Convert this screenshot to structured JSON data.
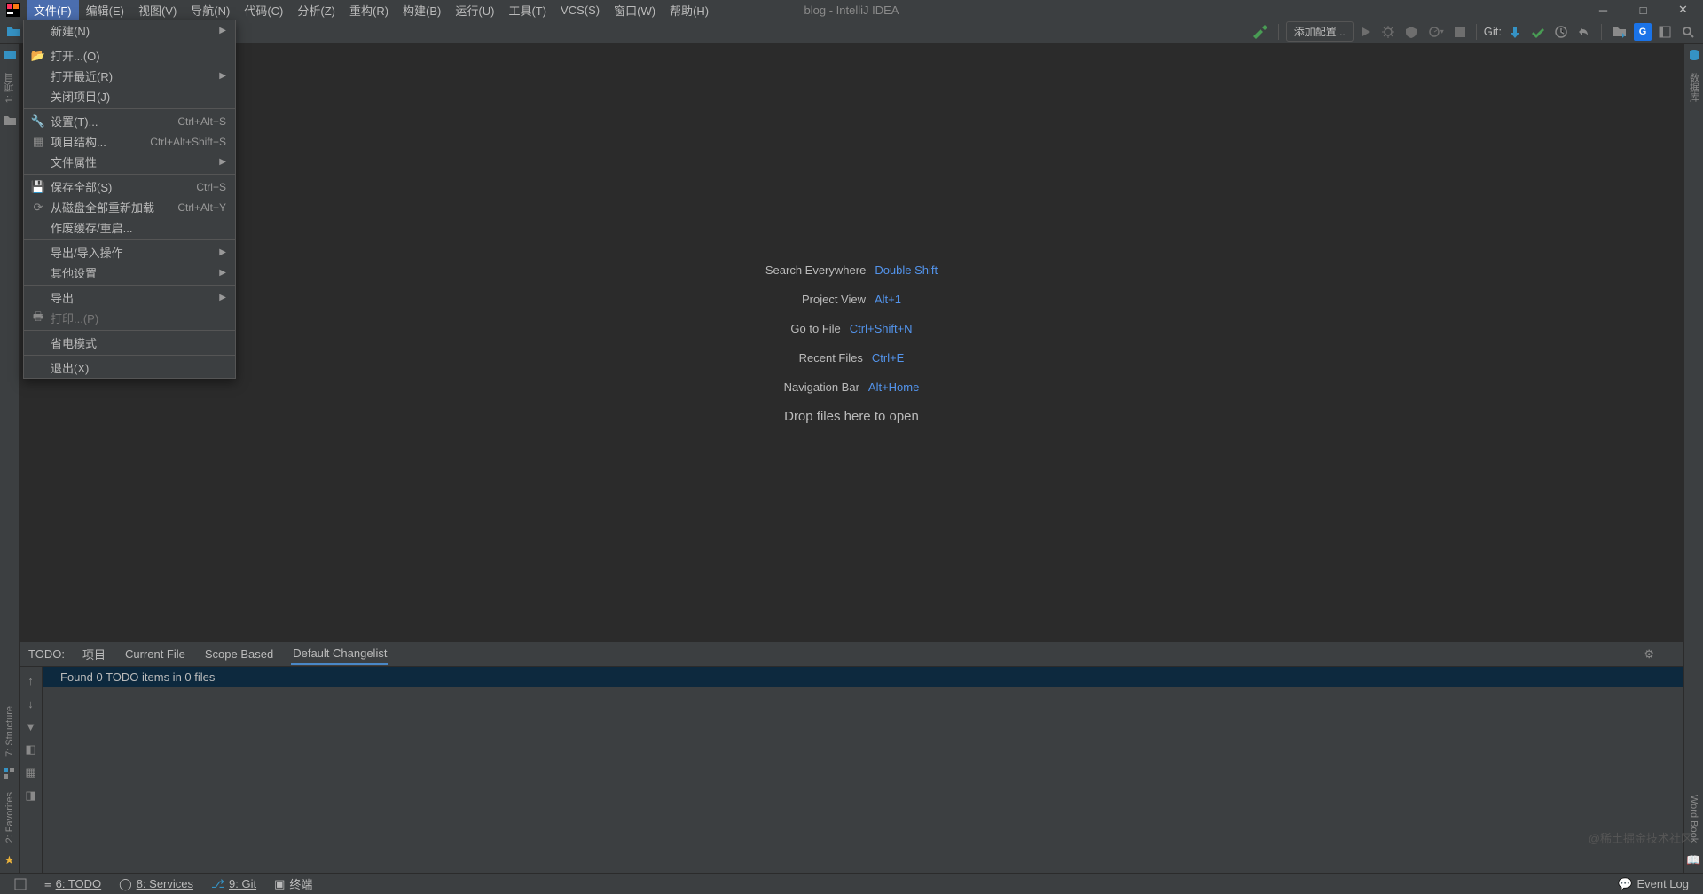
{
  "window": {
    "title": "blog - IntelliJ IDEA"
  },
  "menubar": {
    "items": [
      {
        "label": "文件(F)",
        "active": true
      },
      {
        "label": "编辑(E)"
      },
      {
        "label": "视图(V)"
      },
      {
        "label": "导航(N)"
      },
      {
        "label": "代码(C)"
      },
      {
        "label": "分析(Z)"
      },
      {
        "label": "重构(R)"
      },
      {
        "label": "构建(B)"
      },
      {
        "label": "运行(U)"
      },
      {
        "label": "工具(T)"
      },
      {
        "label": "VCS(S)"
      },
      {
        "label": "窗口(W)"
      },
      {
        "label": "帮助(H)"
      }
    ]
  },
  "dropdown": {
    "new": "新建(N)",
    "open": "打开...(O)",
    "open_recent": "打开最近(R)",
    "close_project": "关闭项目(J)",
    "settings": "设置(T)...",
    "settings_key": "Ctrl+Alt+S",
    "project_structure": "项目结构...",
    "project_structure_key": "Ctrl+Alt+Shift+S",
    "file_properties": "文件属性",
    "save_all": "保存全部(S)",
    "save_all_key": "Ctrl+S",
    "reload_disk": "从磁盘全部重新加载",
    "reload_disk_key": "Ctrl+Alt+Y",
    "invalidate_caches": "作废缓存/重启...",
    "export_import": "导出/导入操作",
    "other_settings": "其他设置",
    "export": "导出",
    "print": "打印...(P)",
    "power_save": "省电模式",
    "exit": "退出(X)"
  },
  "toolbar": {
    "add_config": "添加配置...",
    "git_label": "Git:"
  },
  "empty_editor": {
    "search": {
      "label": "Search Everywhere",
      "key": "Double Shift"
    },
    "project": {
      "label": "Project View",
      "key": "Alt+1"
    },
    "gotofile": {
      "label": "Go to File",
      "key": "Ctrl+Shift+N"
    },
    "recent": {
      "label": "Recent Files",
      "key": "Ctrl+E"
    },
    "navbar": {
      "label": "Navigation Bar",
      "key": "Alt+Home"
    },
    "drop": "Drop files here to open"
  },
  "left_gutter": {
    "project": "1: 项目",
    "structure": "7: Structure",
    "favorites": "2: Favorites"
  },
  "right_gutter": {
    "database": "数据库",
    "wordbook": "Word Book"
  },
  "todo": {
    "label": "TODO:",
    "tabs": {
      "project": "项目",
      "current": "Current File",
      "scope": "Scope Based",
      "changelist": "Default Changelist"
    },
    "found": "Found 0 TODO items in 0 files"
  },
  "statusbar": {
    "todo": "6: TODO",
    "services": "8: Services",
    "git": "9: Git",
    "terminal": "终端",
    "event_log": "Event Log"
  },
  "watermark": "@稀土掘金技术社区"
}
